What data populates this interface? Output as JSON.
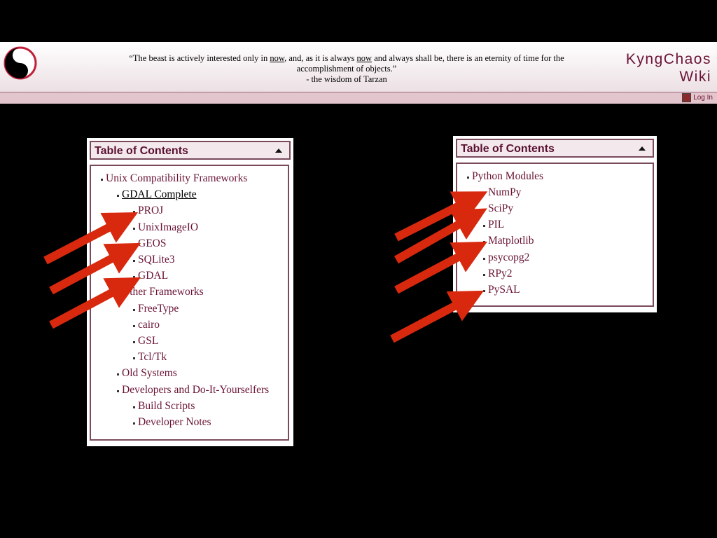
{
  "header": {
    "quote_part1": "“The beast is actively interested only in ",
    "quote_link1": "now",
    "quote_part2": ", and, as it is always ",
    "quote_link2": "now",
    "quote_part3": " and always shall be, there is an eternity of time for the accomplishment of objects.”",
    "quote_attribution": "- the wisdom of Tarzan",
    "site_title_line1": "KyngChaos",
    "site_title_line2": "Wiki",
    "login_label": "Log In"
  },
  "toc_left": {
    "title": "Table of Contents",
    "items": [
      {
        "label": "Unix Compatibility Frameworks",
        "level": 1
      },
      {
        "label": "GDAL Complete",
        "level": 2,
        "current": true
      },
      {
        "label": "PROJ",
        "level": 3
      },
      {
        "label": "UnixImageIO",
        "level": 3
      },
      {
        "label": "GEOS",
        "level": 3
      },
      {
        "label": "SQLite3",
        "level": 3
      },
      {
        "label": "GDAL",
        "level": 3
      },
      {
        "label": "Other Frameworks",
        "level": 2
      },
      {
        "label": "FreeType",
        "level": 3
      },
      {
        "label": "cairo",
        "level": 3
      },
      {
        "label": "GSL",
        "level": 3
      },
      {
        "label": "Tcl/Tk",
        "level": 3
      },
      {
        "label": "Old Systems",
        "level": 2
      },
      {
        "label": "Developers and Do-It-Yourselfers",
        "level": 2
      },
      {
        "label": "Build Scripts",
        "level": 3
      },
      {
        "label": "Developer Notes",
        "level": 3
      }
    ]
  },
  "toc_right": {
    "title": "Table of Contents",
    "items": [
      {
        "label": "Python Modules",
        "level": 1
      },
      {
        "label": "NumPy",
        "level": 2
      },
      {
        "label": "SciPy",
        "level": 2
      },
      {
        "label": "PIL",
        "level": 2
      },
      {
        "label": "Matplotlib",
        "level": 2
      },
      {
        "label": "psycopg2",
        "level": 2
      },
      {
        "label": "RPy2",
        "level": 2
      },
      {
        "label": "PySAL",
        "level": 2
      }
    ]
  },
  "colors": {
    "accent": "#6a1434",
    "arrow": "#d8290f",
    "background": "#000000"
  },
  "icons": [
    "yin-yang-icon",
    "lock-icon",
    "collapse-triangle-icon",
    "arrow-annotation"
  ]
}
